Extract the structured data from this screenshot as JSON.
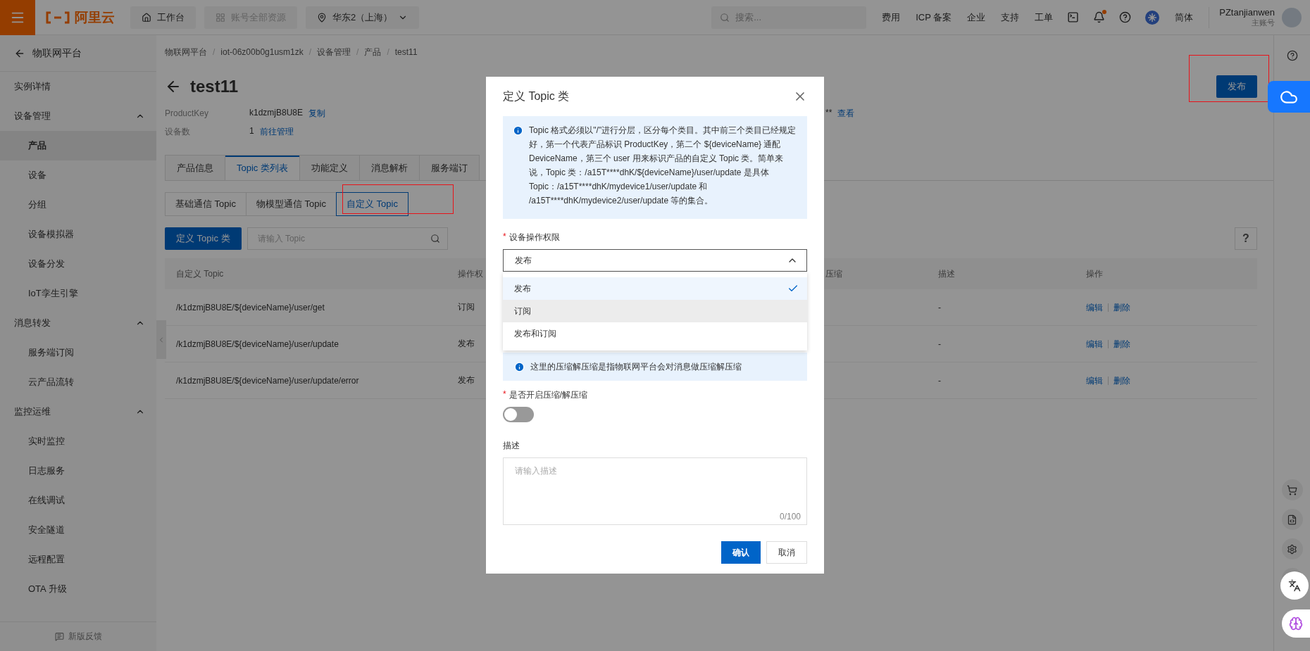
{
  "topbar": {
    "logo": "阿里云",
    "workbench": "工作台",
    "resources": "账号全部资源",
    "region": "华东2（上海）",
    "search": {
      "placeholder": "搜索..."
    },
    "links": [
      "费用",
      "ICP 备案",
      "企业",
      "支持",
      "工单"
    ],
    "notification_dot": true,
    "language": "简体",
    "user": {
      "name": "PZtanjianwen",
      "role": "主账号"
    }
  },
  "sidebar": {
    "back": "物联网平台",
    "items": [
      {
        "label": "实例详情",
        "kind": "item",
        "selected": false
      },
      {
        "label": "设备管理",
        "kind": "group",
        "expanded": true,
        "children": [
          {
            "label": "产品",
            "selected": true
          },
          {
            "label": "设备",
            "selected": false
          },
          {
            "label": "分组",
            "selected": false
          },
          {
            "label": "设备模拟器",
            "selected": false
          },
          {
            "label": "设备分发",
            "selected": false
          },
          {
            "label": "IoT孪生引擎",
            "selected": false
          }
        ]
      },
      {
        "label": "消息转发",
        "kind": "group",
        "expanded": true,
        "children": [
          {
            "label": "服务端订阅",
            "selected": false
          },
          {
            "label": "云产品流转",
            "selected": false
          }
        ]
      },
      {
        "label": "监控运维",
        "kind": "group",
        "expanded": true,
        "children": [
          {
            "label": "实时监控",
            "selected": false
          },
          {
            "label": "日志服务",
            "selected": false
          },
          {
            "label": "在线调试",
            "selected": false
          },
          {
            "label": "安全隧道",
            "selected": false
          },
          {
            "label": "远程配置",
            "selected": false
          },
          {
            "label": "OTA 升级",
            "selected": false
          }
        ]
      }
    ],
    "feedback": "新版反馈"
  },
  "breadcrumb": {
    "separator": "/",
    "items": [
      "物联网平台",
      "iot-06z00b0g1usm1zk",
      "设备管理",
      "产品",
      "test11"
    ]
  },
  "page": {
    "title": "test11",
    "publish_button": "发布",
    "info": [
      {
        "label": "ProductKey",
        "value": "k1dzmjB8U8E",
        "link": "复制"
      },
      {
        "label": "设备数",
        "value": "1",
        "link": "前往管理"
      }
    ],
    "secret": {
      "value": "**",
      "link": "查看"
    }
  },
  "tabs": [
    {
      "label": "产品信息",
      "selected": false
    },
    {
      "label": "Topic 类列表",
      "selected": true
    },
    {
      "label": "功能定义",
      "selected": false
    },
    {
      "label": "消息解析",
      "selected": false
    },
    {
      "label": "服务端订",
      "selected": false
    }
  ],
  "subtabs": [
    {
      "label": "基础通信 Topic",
      "selected": false
    },
    {
      "label": "物模型通信 Topic",
      "selected": false
    },
    {
      "label": "自定义 Topic",
      "selected": true
    }
  ],
  "toolbar": {
    "define_button": "定义 Topic 类",
    "search": {
      "placeholder": "请输入 Topic"
    },
    "help": "?"
  },
  "table": {
    "columns": [
      "自定义 Topic",
      "操作权",
      "压缩",
      "描述",
      "操作"
    ],
    "rows": [
      {
        "topic": "/k1dzmjB8U8E/${deviceName}/user/get",
        "permission": "订阅",
        "description": "-",
        "actions": [
          "编辑",
          "删除"
        ]
      },
      {
        "topic": "/k1dzmjB8U8E/${deviceName}/user/update",
        "permission": "发布",
        "description": "-",
        "actions": [
          "编辑",
          "删除"
        ]
      },
      {
        "topic": "/k1dzmjB8U8E/${deviceName}/user/update/error",
        "permission": "发布",
        "description": "-",
        "actions": [
          "编辑",
          "删除"
        ]
      }
    ]
  },
  "modal": {
    "title": "定义 Topic 类",
    "info": "Topic 格式必须以\"/\"进行分层，区分每个类目。其中前三个类目已经规定好，第一个代表产品标识 ProductKey，第二个 ${deviceName} 通配 DeviceName，第三个 user 用来标识产品的自定义 Topic 类。简单来说，Topic 类：/a15T****dhK/${deviceName}/user/update 是具体 Topic：/a15T****dhK/mydevice1/user/update 和 /a15T****dhK/mydevice2/user/update 等的集合。",
    "permission": {
      "label": "设备操作权限",
      "required_mark": "*",
      "value": "发布",
      "expanded": true,
      "options": [
        {
          "label": "发布",
          "selected": true,
          "hovered": false
        },
        {
          "label": "订阅",
          "selected": false,
          "hovered": true
        },
        {
          "label": "发布和订阅",
          "selected": false,
          "hovered": false
        }
      ]
    },
    "compress_info": "这里的压缩解压缩是指物联网平台会对消息做压缩解压缩",
    "compress": {
      "label": "是否开启压缩/解压缩",
      "required_mark": "*",
      "on": false
    },
    "description": {
      "label": "描述",
      "placeholder": "请输入描述",
      "counter": "0/100"
    },
    "buttons": [
      {
        "label": "确认",
        "kind": "primary"
      },
      {
        "label": "取消",
        "kind": "secondary"
      }
    ]
  }
}
